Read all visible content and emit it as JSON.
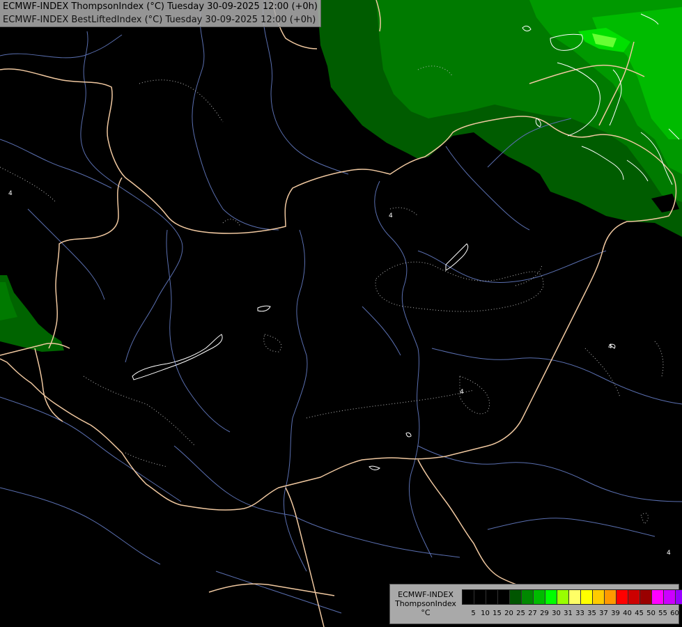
{
  "header": {
    "line1": "ECMWF-INDEX ThompsonIndex (°C) Tuesday 30-09-2025 12:00 (+0h)",
    "line2": "ECMWF-INDEX BestLiftedIndex (°C) Tuesday 30-09-2025 12:00 (+0h)"
  },
  "map": {
    "contour_labels": [
      "4",
      "4",
      "4",
      "4",
      "4"
    ]
  },
  "legend": {
    "line1": "ECMWF-INDEX",
    "line2": "ThompsonIndex",
    "unit": "°C",
    "colors": [
      "#000000",
      "#000000",
      "#000000",
      "#000000",
      "#005500",
      "#008800",
      "#00bb00",
      "#00ff00",
      "#99ff00",
      "#ffff66",
      "#ffff00",
      "#ffcc00",
      "#ff9900",
      "#ff0000",
      "#cc0000",
      "#990000",
      "#ff00ff",
      "#cc00ff",
      "#9900ff",
      "#0000ff"
    ],
    "labels": [
      "5",
      "10",
      "15",
      "20",
      "25",
      "27",
      "29",
      "30",
      "31",
      "33",
      "35",
      "37",
      "39",
      "40",
      "45",
      "50",
      "55",
      "60"
    ]
  }
}
